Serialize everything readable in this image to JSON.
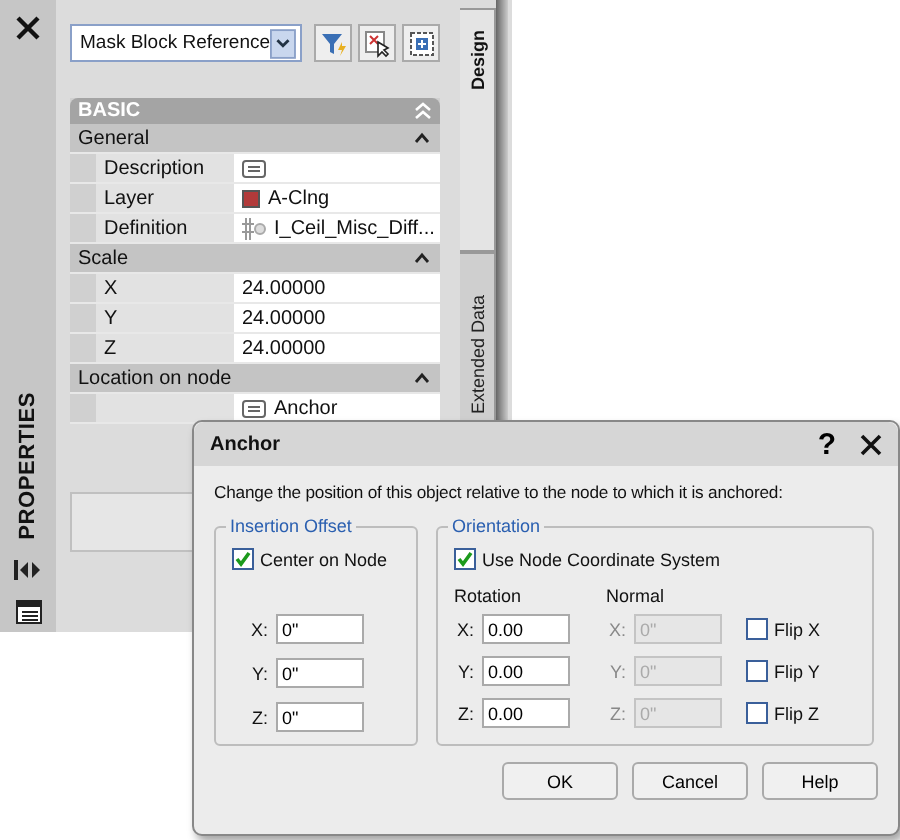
{
  "palette": {
    "title": "PROPERTIES",
    "object_type": "Mask Block Reference",
    "tabs": [
      {
        "label": "Design",
        "selected": true
      },
      {
        "label": "Extended Data",
        "selected": false
      }
    ],
    "category": "BASIC",
    "groups": [
      {
        "title": "General",
        "expanded": true,
        "rows": [
          {
            "label": "Description",
            "value": "",
            "kind": "text"
          },
          {
            "label": "Layer",
            "value": "A-Clng",
            "kind": "layer"
          },
          {
            "label": "Definition",
            "value": "I_Ceil_Misc_Diff...",
            "kind": "block"
          }
        ]
      },
      {
        "title": "Scale",
        "expanded": true,
        "rows": [
          {
            "label": "X",
            "value": "24.00000"
          },
          {
            "label": "Y",
            "value": "24.00000"
          },
          {
            "label": "Z",
            "value": "24.00000"
          }
        ]
      },
      {
        "title": "Location on node",
        "expanded": true,
        "rows": [
          {
            "label": "",
            "value": "Anchor",
            "kind": "text"
          }
        ]
      }
    ]
  },
  "dialog": {
    "title": "Anchor",
    "help": "?",
    "message": "Change the position of this object relative to the node to which it is anchored:",
    "insertion_offset": {
      "title": "Insertion Offset",
      "center_on_node": {
        "label": "Center on Node",
        "checked": true
      },
      "fields": [
        {
          "axis": "X:",
          "value": "0\""
        },
        {
          "axis": "Y:",
          "value": "0\""
        },
        {
          "axis": "Z:",
          "value": "0\""
        }
      ]
    },
    "orientation": {
      "title": "Orientation",
      "use_node_cs": {
        "label": "Use Node Coordinate System",
        "checked": true
      },
      "rotation_label": "Rotation",
      "normal_label": "Normal",
      "rows": [
        {
          "axis": "X:",
          "rotation": "0.00",
          "normal_axis": "X:",
          "normal": "0\"",
          "normal_disabled": true,
          "flip": {
            "label": "Flip X",
            "checked": false
          }
        },
        {
          "axis": "Y:",
          "rotation": "0.00",
          "normal_axis": "Y:",
          "normal": "0\"",
          "normal_disabled": true,
          "flip": {
            "label": "Flip Y",
            "checked": false
          }
        },
        {
          "axis": "Z:",
          "rotation": "0.00",
          "normal_axis": "Z:",
          "normal": "0\"",
          "normal_disabled": true,
          "flip": {
            "label": "Flip Z",
            "checked": false
          }
        }
      ]
    },
    "buttons": [
      "OK",
      "Cancel",
      "Help"
    ]
  }
}
